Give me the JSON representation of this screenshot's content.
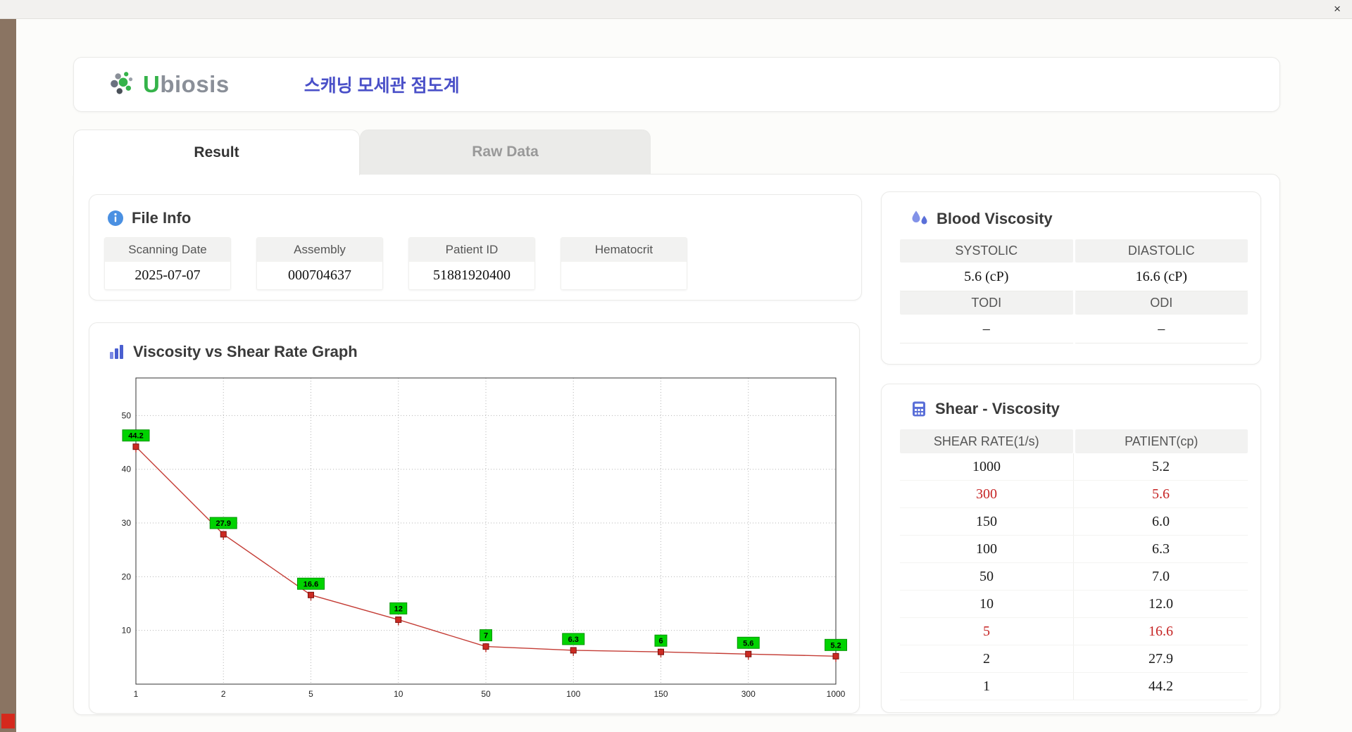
{
  "window": {
    "close_glyph": "×"
  },
  "header": {
    "logo_accent": "U",
    "logo_rest": "biosis",
    "title": "스캐닝 모세관 점도계"
  },
  "tabs": [
    {
      "label": "Result",
      "active": true
    },
    {
      "label": "Raw Data",
      "active": false
    }
  ],
  "icons": {
    "file_info": "info-icon",
    "blood_viscosity": "droplets-icon",
    "graph": "bar-chart-icon",
    "shear_viscosity": "calculator-icon"
  },
  "file_info": {
    "title": "File Info",
    "fields": [
      {
        "label": "Scanning Date",
        "value": "2025-07-07"
      },
      {
        "label": "Assembly",
        "value": "000704637"
      },
      {
        "label": "Patient ID",
        "value": "51881920400"
      },
      {
        "label": "Hematocrit",
        "value": ""
      }
    ]
  },
  "blood_viscosity": {
    "title": "Blood Viscosity",
    "top": {
      "labels": [
        "SYSTOLIC",
        "DIASTOLIC"
      ],
      "values": [
        "5.6 (cP)",
        "16.6 (cP)"
      ]
    },
    "bottom": {
      "labels": [
        "TODI",
        "ODI"
      ],
      "values": [
        "–",
        "–"
      ]
    }
  },
  "graph": {
    "title": "Viscosity vs Shear Rate Graph"
  },
  "chart_data": {
    "type": "line",
    "title": "Viscosity vs Shear Rate Graph",
    "x_labels": [
      "1",
      "2",
      "5",
      "10",
      "50",
      "100",
      "150",
      "300",
      "1000"
    ],
    "values": [
      44.2,
      27.9,
      16.6,
      12,
      7,
      6.3,
      6,
      5.6,
      5.2
    ],
    "point_labels": [
      "44.2",
      "27.9",
      "16.6",
      "12",
      "7",
      "6.3",
      "6",
      "5.6",
      "5.2"
    ],
    "y_ticks": [
      10,
      20,
      30,
      40,
      50
    ],
    "ylim": [
      0,
      57
    ],
    "xlabel": "",
    "ylabel": "",
    "grid": "dotted",
    "line_color": "#c43c35",
    "marker_color": "#cc2a22",
    "marker_edge": "#7a100c",
    "label_bg": "#00d300",
    "label_edge": "#009400",
    "axis_color": "#333333"
  },
  "shear_viscosity": {
    "title": "Shear - Viscosity",
    "columns": [
      "SHEAR RATE(1/s)",
      "PATIENT(cp)"
    ],
    "rows": [
      {
        "rate": "1000",
        "value": "5.2",
        "highlight": false
      },
      {
        "rate": "300",
        "value": "5.6",
        "highlight": true
      },
      {
        "rate": "150",
        "value": "6.0",
        "highlight": false
      },
      {
        "rate": "100",
        "value": "6.3",
        "highlight": false
      },
      {
        "rate": "50",
        "value": "7.0",
        "highlight": false
      },
      {
        "rate": "10",
        "value": "12.0",
        "highlight": false
      },
      {
        "rate": "5",
        "value": "16.6",
        "highlight": true
      },
      {
        "rate": "2",
        "value": "27.9",
        "highlight": false
      },
      {
        "rate": "1",
        "value": "44.2",
        "highlight": false
      }
    ]
  }
}
